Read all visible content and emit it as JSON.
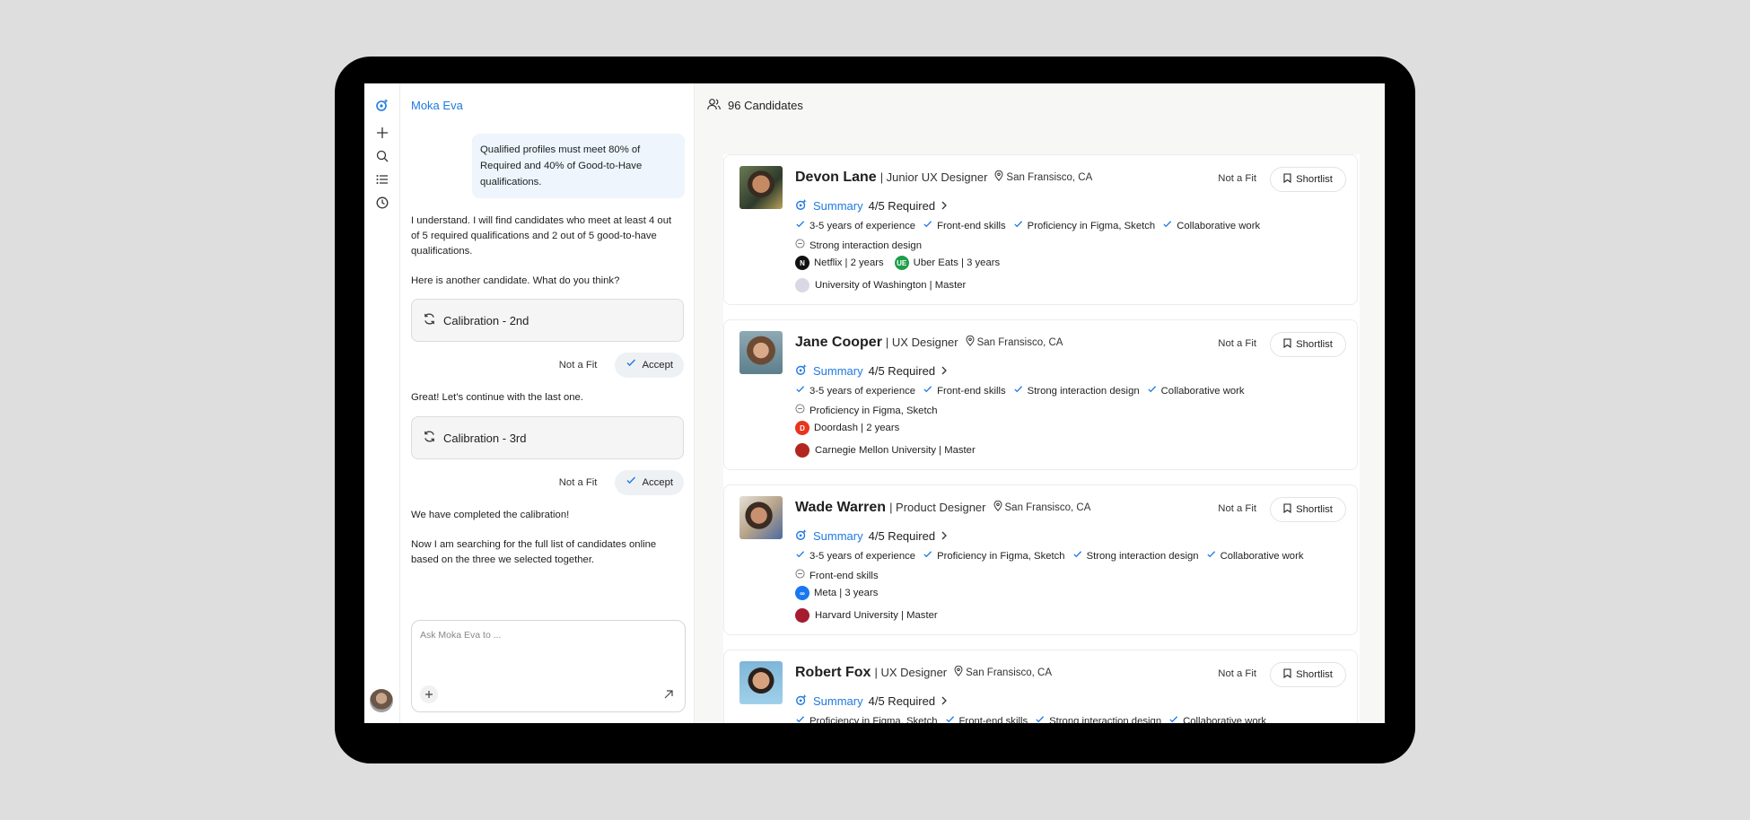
{
  "app": {
    "assistant_name": "Moka Eva"
  },
  "colors": {
    "accent": "#1f7ae0",
    "bubble": "#eef5fd"
  },
  "chat": {
    "user_message": "Qualified profiles must meet 80% of Required and 40% of Good-to-Have qualifications.",
    "reply_1": "I understand. I will find candidates who meet  at least 4 out of  5 required qualifications and 2 out of 5 good-to-have qualifications.",
    "reply_2": "Here is another candidate. What do you think?",
    "calibration_2": "Calibration - 2nd",
    "reply_3": "Great! Let’s continue with the last one.",
    "calibration_3": "Calibration - 3rd",
    "reply_4": "We have completed the calibration!",
    "reply_5": "Now I am searching for the full list of candidates online based on the three we selected together.",
    "not_fit_label": "Not a Fit",
    "accept_label": "Accept",
    "composer_placeholder": "Ask Moka Eva to ..."
  },
  "main": {
    "candidate_count": "96 Candidates"
  },
  "candidates": [
    {
      "name": "Devon Lane",
      "role": "| Junior UX Designer",
      "location": "San Fransisco, CA",
      "not_fit": "Not a Fit",
      "shortlist": "Shortlist",
      "summary": "Summary",
      "required": "4/5 Required",
      "skills": [
        {
          "ok": true,
          "text": "3-5 years of experience"
        },
        {
          "ok": true,
          "text": "Front-end skills"
        },
        {
          "ok": true,
          "text": "Proficiency in Figma, Sketch"
        },
        {
          "ok": true,
          "text": "Collaborative work"
        },
        {
          "ok": false,
          "text": "Strong interaction design"
        }
      ],
      "experience": [
        {
          "company": "Netflix | 2 years",
          "logo_color": "#111111",
          "logo_glyph": "N"
        },
        {
          "company": "Uber Eats | 3 years",
          "logo_color": "#1f9e4a",
          "logo_glyph": "UE"
        }
      ],
      "education": "University of Washington | Master",
      "edu_color": "#d9d9e6"
    },
    {
      "name": "Jane Cooper",
      "role": "| UX Designer",
      "location": "San Fransisco, CA",
      "not_fit": "Not a Fit",
      "shortlist": "Shortlist",
      "summary": "Summary",
      "required": "4/5 Required",
      "skills": [
        {
          "ok": true,
          "text": "3-5 years of experience"
        },
        {
          "ok": true,
          "text": "Front-end skills"
        },
        {
          "ok": true,
          "text": "Strong interaction design"
        },
        {
          "ok": true,
          "text": "Collaborative work"
        },
        {
          "ok": false,
          "text": "Proficiency in Figma, Sketch"
        }
      ],
      "experience": [
        {
          "company": "Doordash | 2 years",
          "logo_color": "#e8341c",
          "logo_glyph": "D"
        }
      ],
      "education": "Carnegie Mellon University | Master",
      "edu_color": "#b3261e"
    },
    {
      "name": "Wade Warren",
      "role": "| Product Designer",
      "location": "San Fransisco, CA",
      "not_fit": "Not a Fit",
      "shortlist": "Shortlist",
      "summary": "Summary",
      "required": "4/5 Required",
      "skills": [
        {
          "ok": true,
          "text": "3-5 years of experience"
        },
        {
          "ok": true,
          "text": "Proficiency in Figma, Sketch"
        },
        {
          "ok": true,
          "text": "Strong interaction design"
        },
        {
          "ok": true,
          "text": "Collaborative work"
        },
        {
          "ok": false,
          "text": "Front-end skills"
        }
      ],
      "experience": [
        {
          "company": "Meta | 3 years",
          "logo_color": "#1877f2",
          "logo_glyph": "∞"
        }
      ],
      "education": "Harvard University | Master",
      "edu_color": "#a51c30"
    },
    {
      "name": "Robert Fox",
      "role": "| UX Designer",
      "location": "San Fransisco, CA",
      "not_fit": "Not a Fit",
      "shortlist": "Shortlist",
      "summary": "Summary",
      "required": "4/5 Required",
      "skills": [
        {
          "ok": true,
          "text": "Proficiency in Figma, Sketch"
        },
        {
          "ok": true,
          "text": "Front-end skills"
        },
        {
          "ok": true,
          "text": "Strong interaction design"
        },
        {
          "ok": true,
          "text": "Collaborative work"
        }
      ],
      "experience": [],
      "education": "",
      "edu_color": "#cccccc"
    }
  ]
}
